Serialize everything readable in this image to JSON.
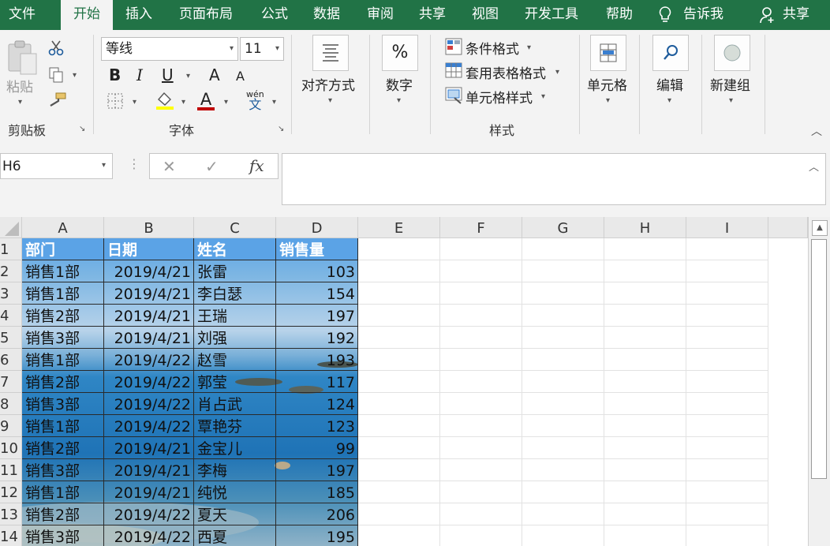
{
  "tabs": {
    "file": "文件",
    "home": "开始",
    "insert": "插入",
    "page_layout": "页面布局",
    "formulas": "公式",
    "data": "数据",
    "review": "审阅",
    "share_menu": "共享",
    "view": "视图",
    "developer": "开发工具",
    "help": "帮助",
    "tell_me": "告诉我",
    "share": "共享"
  },
  "ribbon": {
    "clipboard": {
      "paste": "粘贴",
      "group_label": "剪贴板"
    },
    "font": {
      "name": "等线",
      "size": "11",
      "bold": "B",
      "italic": "I",
      "underline": "U",
      "grow": "A",
      "shrink": "A",
      "color_a": "A",
      "phonetic_top": "wén",
      "phonetic_bottom": "文",
      "group_label": "字体"
    },
    "alignment": {
      "label": "对齐方式"
    },
    "number": {
      "label": "数字",
      "icon_text": "%"
    },
    "styles": {
      "conditional": "条件格式",
      "table_format": "套用表格格式",
      "cell_styles": "单元格样式",
      "group_label": "样式"
    },
    "cells": {
      "label": "单元格"
    },
    "editing": {
      "label": "编辑"
    },
    "new_group": {
      "label": "新建组"
    }
  },
  "formula_bar": {
    "name_box": "H6",
    "cancel": "✕",
    "enter": "✓",
    "fx": "fx",
    "value": ""
  },
  "columns": [
    "A",
    "B",
    "C",
    "D",
    "E",
    "F",
    "G",
    "H",
    "I"
  ],
  "rows": [
    "1",
    "2",
    "3",
    "4",
    "5",
    "6",
    "7",
    "8",
    "9",
    "10",
    "11",
    "12",
    "13",
    "14"
  ],
  "table": {
    "headers": [
      "部门",
      "日期",
      "姓名",
      "销售量"
    ],
    "rows": [
      [
        "销售1部",
        "2019/4/21",
        "张雷",
        "103"
      ],
      [
        "销售1部",
        "2019/4/21",
        "李白瑟",
        "154"
      ],
      [
        "销售2部",
        "2019/4/21",
        "王瑞",
        "197"
      ],
      [
        "销售3部",
        "2019/4/21",
        "刘强",
        "192"
      ],
      [
        "销售1部",
        "2019/4/22",
        "赵雪",
        "193"
      ],
      [
        "销售2部",
        "2019/4/22",
        "郭莹",
        "117"
      ],
      [
        "销售3部",
        "2019/4/22",
        "肖占武",
        "124"
      ],
      [
        "销售1部",
        "2019/4/22",
        "覃艳芬",
        "123"
      ],
      [
        "销售2部",
        "2019/4/21",
        "金宝儿",
        "99"
      ],
      [
        "销售3部",
        "2019/4/21",
        "李梅",
        "197"
      ],
      [
        "销售1部",
        "2019/4/21",
        "纯悦",
        "185"
      ],
      [
        "销售2部",
        "2019/4/22",
        "夏天",
        "206"
      ],
      [
        "销售3部",
        "2019/4/22",
        "西夏",
        "195"
      ]
    ]
  },
  "colors": {
    "accent": "#217346",
    "header_fill": "#5ba3e6",
    "sea_top": "#a9c8e8",
    "sea_mid": "#2a7fbf",
    "sea_deep": "#1d6aa8"
  }
}
